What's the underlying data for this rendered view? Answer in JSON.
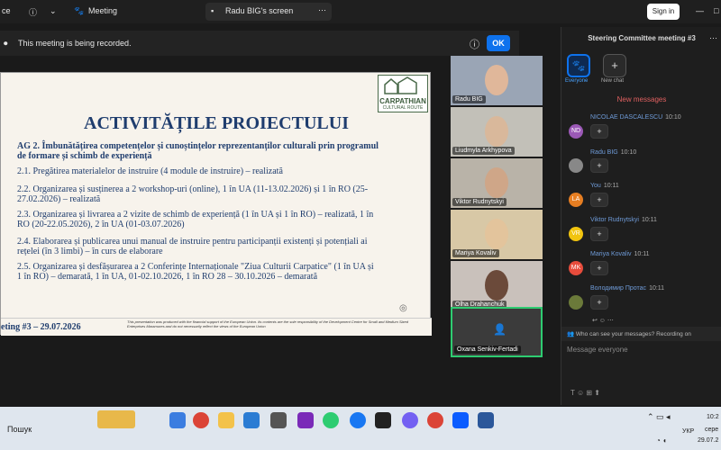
{
  "topbar": {
    "left_text": "ce",
    "info_icon": "info-icon",
    "chevron": "chevron-down-icon",
    "meeting_label": "Meeting",
    "share_label": "Radu BIG's screen",
    "signin_label": "Sign in"
  },
  "recording": {
    "text": "This meeting is being recorded.",
    "ok_label": "OK"
  },
  "slide": {
    "title": "ACTIVITĂȚILE PROIECTULUI",
    "ag": "AG 2. Îmbunătățirea competențelor și cunoștințelor reprezentanților culturali prin programul de formare și schimb de experiență",
    "items": [
      "2.1. Pregătirea materialelor de instruire (4 module de instruire) – realizată",
      "2.2. Organizarea și susținerea a 2 workshop-uri (online), 1 în UA (11-13.02.2026) și 1 în RO (25-27.02.2026) – realizată",
      "2.3. Organizarea și livrarea a 2 vizite de schimb de experiență (1 în UA și 1 în RO) – realizată, 1 în RO (20-22.05.2026), 2 în UA (01-03.07.2026)",
      "2.4. Elaborarea și publicarea unui manual de instruire pentru participanții existenți și potențiali ai rețelei (în 3 limbi) – în curs de elaborare",
      "2.5. Organizarea și desfășurarea a 2 Conferințe Internaționale \"Ziua Culturii Carpatice\" (1 în UA și 1 în RO) – demarată, 1 în UA, 01-02.10.2026, 1 în RO 28 – 30.10.2026 – demarată"
    ],
    "footer_left": "eting #3 – 29.07.2026",
    "footer_note": "This presentation was produced with the financial support of the European Union. Its contents are the sole responsibility of the Development Centre for Small and Medium Sized Enterprises Maramures and do not necessarily reflect the views of the European Union",
    "logo_text": "CARPATHIAN",
    "logo_sub": "CULTURAL ROUTE"
  },
  "participants": [
    {
      "name": "Radu BIG"
    },
    {
      "name": "Liudmyla Arkhypova"
    },
    {
      "name": "Viktor Rudnytskyi"
    },
    {
      "name": "Mariya Kovaliv"
    },
    {
      "name": "Olha Drahanchuk"
    },
    {
      "name": "Oxana Senkiv-Fertadi"
    }
  ],
  "chat": {
    "title": "Steering Committee meeting #3",
    "everyone_label": "Everyone",
    "newchat_label": "New chat",
    "new_messages": "New messages",
    "messages": [
      {
        "initials": "ND",
        "name": "NICOLAE DASCALESCU",
        "time": "10:10",
        "color": "#9b59b6"
      },
      {
        "initials": "",
        "name": "Radu BIG",
        "time": "10:10",
        "color": "#888888"
      },
      {
        "initials": "LA",
        "name": "You",
        "time": "10:11",
        "color": "#e67e22"
      },
      {
        "initials": "VR",
        "name": "Viktor Rudnytskyi",
        "time": "10:11",
        "color": "#f1c40f"
      },
      {
        "initials": "MK",
        "name": "Mariya Kovaliv",
        "time": "10:11",
        "color": "#e74c3c"
      },
      {
        "initials": "",
        "name": "Володимир Протас",
        "time": "10:11",
        "color": "#6b7a3a"
      }
    ],
    "plus": "+",
    "who_can_see": "Who can see your messages? Recording on",
    "input_placeholder": "Message everyone"
  },
  "taskbar": {
    "search_label": "Пошук",
    "lang": "УКР",
    "time": "10:2",
    "day": "сере",
    "date": "29.07.2"
  }
}
